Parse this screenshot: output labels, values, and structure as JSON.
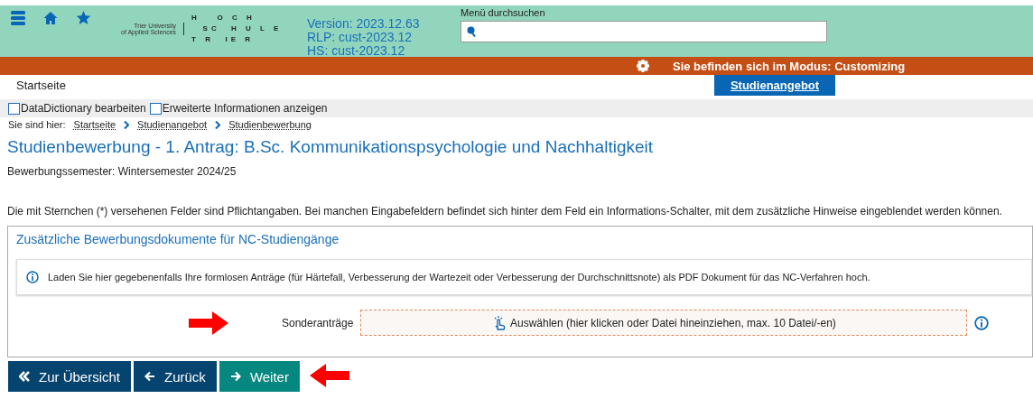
{
  "header": {
    "logo": {
      "tagline_1": "Trier University",
      "tagline_2": "of Applied Sciences",
      "wordmark": [
        "H   O C H",
        "  SC  H U L E",
        "T R  IE R"
      ]
    },
    "version_lines": [
      "Version: 2023.12.63",
      "RLP: cust-2023.12",
      "HS: cust-2023.12"
    ],
    "search": {
      "label": "Menü durchsuchen"
    }
  },
  "mode_bar": {
    "text": "Sie befinden sich im Modus: Customizing"
  },
  "nav_tabs": [
    {
      "label": "Startseite",
      "selected": false
    },
    {
      "label": "Studienangebot",
      "selected": true
    }
  ],
  "options": [
    {
      "label": "DataDictionary bearbeiten",
      "checked": false
    },
    {
      "label": "Erweiterte Informationen anzeigen",
      "checked": false
    }
  ],
  "breadcrumb": {
    "prefix": "Sie sind hier:",
    "items": [
      "Startseite",
      "Studienangebot",
      "Studienbewerbung"
    ]
  },
  "title": "Studienbewerbung - 1. Antrag: B.Sc. Kommunikationspsychologie und Nachhaltigkeit",
  "subtitle": "Bewerbungssemester: Wintersemester 2024/25",
  "intro": "Die mit Sternchen (*) versehenen Felder sind Pflichtangaben. Bei manchen Eingabefeldern befindet sich hinter dem Feld ein Informations-Schalter, mit dem zusätzliche Hinweise eingeblendet werden können.",
  "panel": {
    "title": "Zusätzliche Bewerbungsdokumente für NC-Studiengänge",
    "info": "Laden Sie hier gegebenenfalls Ihre formlosen Anträge (für Härtefall, Verbesserung der Wartezeit oder Verbesserung der Durchschnittsnote) als PDF Dokument für das NC-Verfahren hoch.",
    "upload": {
      "label": "Sonderanträge",
      "button": "Auswählen (hier klicken oder Datei hineinziehen, max. 10 Datei/-en)"
    }
  },
  "buttons": [
    {
      "kind": "overview",
      "label": "Zur Übersicht"
    },
    {
      "kind": "back",
      "label": "Zurück"
    },
    {
      "kind": "next",
      "label": "Weiter"
    }
  ]
}
